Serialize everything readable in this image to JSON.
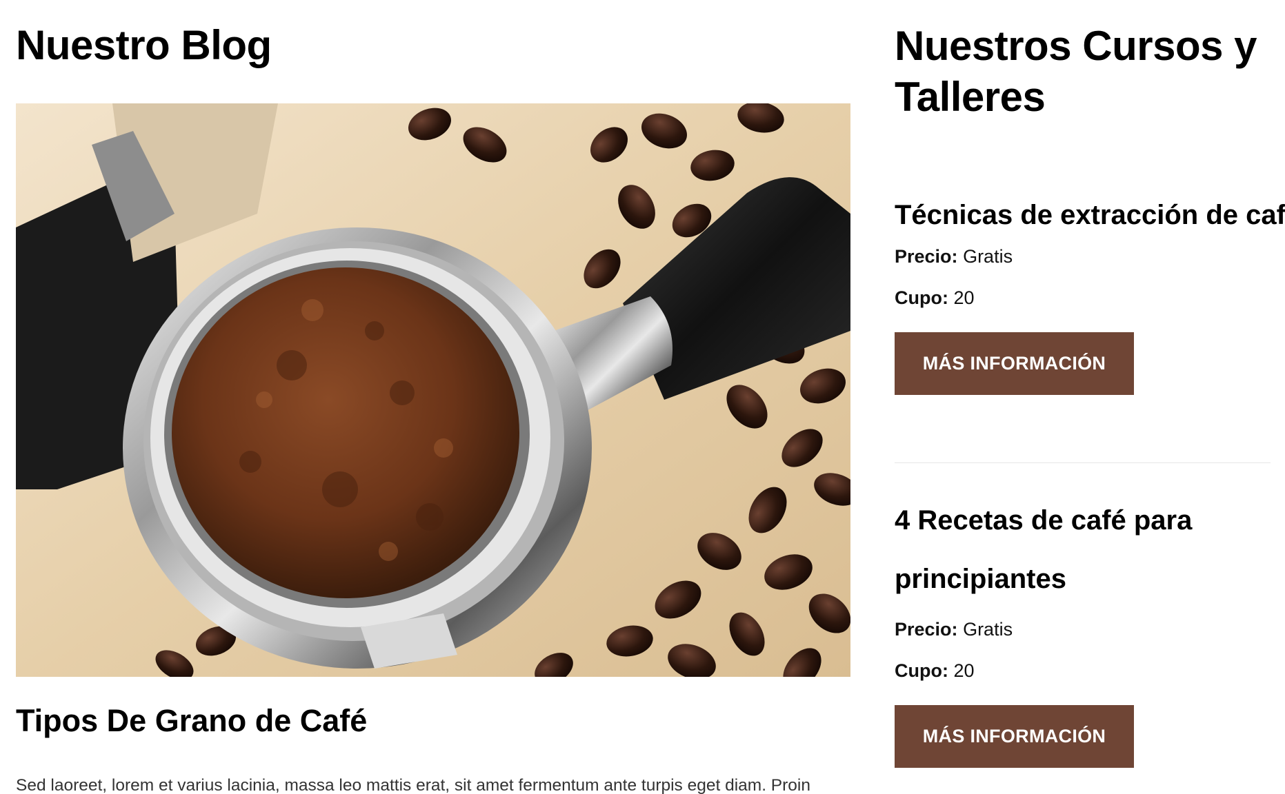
{
  "blog": {
    "heading": "Nuestro Blog",
    "image_alt": "Portafiltro con café molido y granos de café",
    "post": {
      "title": "Tipos De Grano de Café",
      "excerpt": "Sed laoreet, lorem et varius lacinia, massa leo mattis erat, sit amet fermentum ante turpis eget diam. Proin"
    }
  },
  "courses": {
    "heading": "Nuestros Cursos y Talleres",
    "price_label": "Precio:",
    "slots_label": "Cupo:",
    "button_label": "MÁS INFORMACIÓN",
    "items": [
      {
        "title": "Técnicas de extracción de café",
        "price": "Gratis",
        "slots": "20"
      },
      {
        "title": "4 Recetas de café para principiantes",
        "price": "Gratis",
        "slots": "20"
      }
    ]
  },
  "colors": {
    "button_bg": "#6f4535",
    "button_text": "#ffffff",
    "heading_text": "#000000",
    "divider": "#e6e6e6"
  }
}
